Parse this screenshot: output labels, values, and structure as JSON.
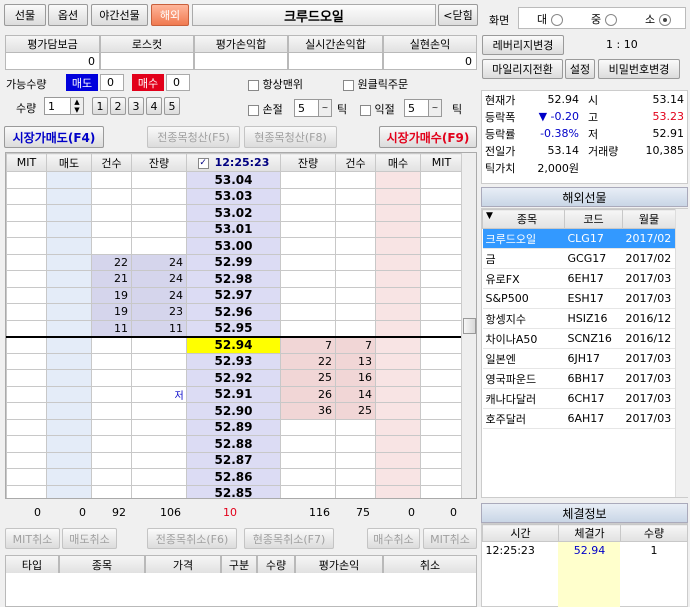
{
  "tabs": [
    "선물",
    "옵션",
    "야간선물",
    "해외"
  ],
  "active_tab": 3,
  "instrument": "크루드오일",
  "close_label": "<닫힘",
  "summary": {
    "headers": [
      "평가담보금",
      "로스컷",
      "평가손익합",
      "실시간손익합",
      "실현손익"
    ],
    "values": [
      "0",
      "",
      "",
      "",
      "0"
    ]
  },
  "avail": {
    "label": "가능수량",
    "sell": "매도",
    "sell_val": "0",
    "buy": "매수",
    "buy_val": "0"
  },
  "always_top": "항상맨위",
  "one_click": "원클릭주문",
  "qty": {
    "label": "수량",
    "value": "1",
    "presets": [
      "1",
      "2",
      "3",
      "4",
      "5"
    ]
  },
  "stoploss": {
    "label": "손절",
    "value": "5",
    "unit": "틱"
  },
  "takeprofit": {
    "label": "익절",
    "value": "5",
    "unit": "틱"
  },
  "action_buttons": [
    "시장가매도(F4)",
    "전종목청산(F5)",
    "현종목청산(F8)",
    "시장가매수(F9)"
  ],
  "book_headers": [
    "MIT",
    "매도",
    "건수",
    "잔량",
    "12:25:23",
    "잔량",
    "건수",
    "매수",
    "MIT"
  ],
  "book": [
    {
      "p": "53.04",
      "sc": "",
      "sq": "",
      "bq": "",
      "bc": ""
    },
    {
      "p": "53.03",
      "sc": "",
      "sq": "",
      "bq": "",
      "bc": ""
    },
    {
      "p": "53.02",
      "sc": "",
      "sq": "",
      "bq": "",
      "bc": ""
    },
    {
      "p": "53.01",
      "sc": "",
      "sq": "",
      "bq": "",
      "bc": ""
    },
    {
      "p": "53.00",
      "sc": "",
      "sq": "",
      "bq": "",
      "bc": ""
    },
    {
      "p": "52.99",
      "sc": "22",
      "sq": "24",
      "bq": "",
      "bc": ""
    },
    {
      "p": "52.98",
      "sc": "21",
      "sq": "24",
      "bq": "",
      "bc": ""
    },
    {
      "p": "52.97",
      "sc": "19",
      "sq": "24",
      "bq": "",
      "bc": ""
    },
    {
      "p": "52.96",
      "sc": "19",
      "sq": "23",
      "bq": "",
      "bc": ""
    },
    {
      "p": "52.95",
      "sc": "11",
      "sq": "11",
      "bq": "",
      "bc": ""
    },
    {
      "p": "52.94",
      "sc": "",
      "sq": "",
      "bq": "7",
      "bc": "7",
      "cur": true
    },
    {
      "p": "52.93",
      "sc": "",
      "sq": "",
      "bq": "22",
      "bc": "13"
    },
    {
      "p": "52.92",
      "sc": "",
      "sq": "",
      "bq": "25",
      "bc": "16"
    },
    {
      "p": "52.91",
      "sc": "",
      "sq": "",
      "bq": "26",
      "bc": "14",
      "low": "저"
    },
    {
      "p": "52.90",
      "sc": "",
      "sq": "",
      "bq": "36",
      "bc": "25"
    },
    {
      "p": "52.89",
      "sc": "",
      "sq": "",
      "bq": "",
      "bc": ""
    },
    {
      "p": "52.88",
      "sc": "",
      "sq": "",
      "bq": "",
      "bc": ""
    },
    {
      "p": "52.87",
      "sc": "",
      "sq": "",
      "bq": "",
      "bc": ""
    },
    {
      "p": "52.86",
      "sc": "",
      "sq": "",
      "bq": "",
      "bc": ""
    },
    {
      "p": "52.85",
      "sc": "",
      "sq": "",
      "bq": "",
      "bc": ""
    }
  ],
  "book_totals": [
    "0",
    "0",
    "92",
    "106",
    "10",
    "116",
    "75",
    "0",
    "0"
  ],
  "cancel_buttons": [
    "MIT취소",
    "매도취소",
    "전종목취소(F6)",
    "현종목취소(F7)",
    "매수취소",
    "MIT취소"
  ],
  "orders_headers": [
    "타입",
    "종목",
    "가격",
    "구분",
    "수량",
    "평가손익",
    "취소"
  ],
  "screen": {
    "label": "화면",
    "options": [
      "대",
      "중",
      "소"
    ],
    "selected": 2
  },
  "side_buttons": [
    "레버리지변경",
    "마일리지전환",
    "설정",
    "비밀번호변경"
  ],
  "leverage": "1 : 10",
  "quote": [
    {
      "l": "현재가",
      "v": "52.94",
      "l2": "시",
      "v2": "53.14"
    },
    {
      "l": "등락폭",
      "v": "▼ -0.20",
      "l2": "고",
      "v2": "53.23"
    },
    {
      "l": "등락률",
      "v": "-0.38%",
      "l2": "저",
      "v2": "52.91"
    },
    {
      "l": "전일가",
      "v": "53.14",
      "l2": "거래량",
      "v2": "10,385"
    },
    {
      "l": "틱가치",
      "v": "2,000원",
      "l2": "",
      "v2": ""
    }
  ],
  "futures_title": "해외선물",
  "futures_headers": [
    "종목",
    "코드",
    "월물"
  ],
  "futures": [
    {
      "n": "크루드오일",
      "c": "CLG17",
      "m": "2017/02"
    },
    {
      "n": "금",
      "c": "GCG17",
      "m": "2017/02"
    },
    {
      "n": "유로FX",
      "c": "6EH17",
      "m": "2017/03"
    },
    {
      "n": "S&P500",
      "c": "ESH17",
      "m": "2017/03"
    },
    {
      "n": "항셍지수",
      "c": "HSIZ16",
      "m": "2016/12"
    },
    {
      "n": "차이나A50",
      "c": "SCNZ16",
      "m": "2016/12"
    },
    {
      "n": "일본엔",
      "c": "6JH17",
      "m": "2017/03"
    },
    {
      "n": "영국파운드",
      "c": "6BH17",
      "m": "2017/03"
    },
    {
      "n": "캐나다달러",
      "c": "6CH17",
      "m": "2017/03"
    },
    {
      "n": "호주달러",
      "c": "6AH17",
      "m": "2017/03"
    }
  ],
  "trades_title": "체결정보",
  "trades_headers": [
    "시간",
    "체결가",
    "수량"
  ],
  "trades": [
    {
      "t": "12:25:23",
      "p": "52.94",
      "q": "1"
    }
  ],
  "colors": {
    "sell_bg": "#d5d5ec",
    "buy_bg": "#f1d6d6",
    "price_bg": "#dcdcf4",
    "current": "#ffff00",
    "red": "#e2001a",
    "blue": "#0000c8",
    "selected": "#3399ff"
  }
}
